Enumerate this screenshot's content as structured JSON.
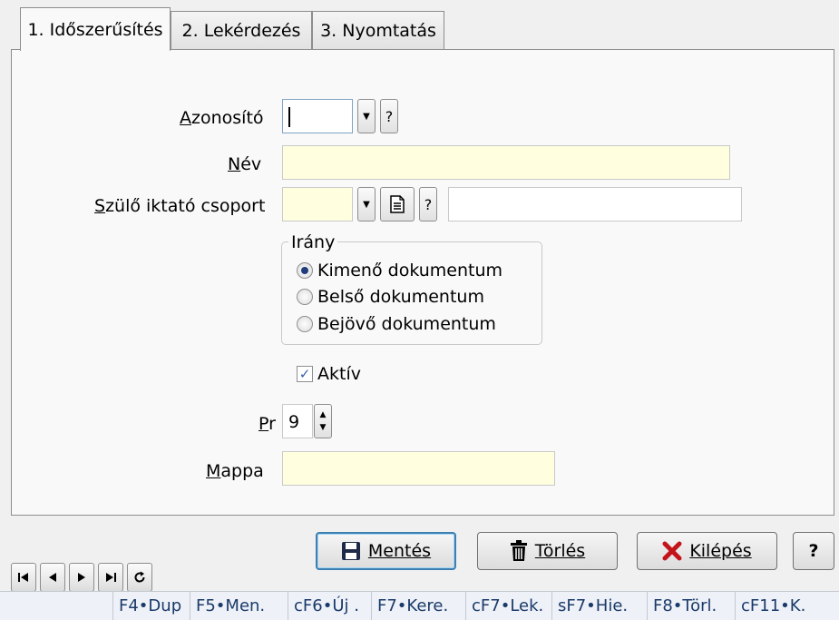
{
  "tabs": [
    {
      "label": "1. Időszerűsítés",
      "active": true
    },
    {
      "label": "2. Lekérdezés",
      "active": false
    },
    {
      "label": "3. Nyomtatás",
      "active": false
    }
  ],
  "form": {
    "azonosito_label": "Azonosító",
    "azonosito_value": "",
    "nev_label": "Név",
    "nev_value": "",
    "szulo_label": "Szülő iktató csoport",
    "szulo_value": "",
    "szulo_desc_value": "",
    "question_mark": "?",
    "irany": {
      "title": "Irány",
      "options": [
        {
          "label": "Kimenő dokumentum",
          "checked": true
        },
        {
          "label": "Belső dokumentum",
          "checked": false
        },
        {
          "label": "Bejövő dokumentum",
          "checked": false
        }
      ]
    },
    "aktiv_label": "Aktív",
    "aktiv_checked": true,
    "pr_label": "Pr",
    "pr_value": "9",
    "mappa_label": "Mappa",
    "mappa_value": ""
  },
  "buttons": {
    "save": "Mentés",
    "delete": "Törlés",
    "exit": "Kilépés",
    "help": "?"
  },
  "statusbar": [
    "F4•Dup",
    "F5•Men.",
    "cF6•Új .",
    "F7•Kere.",
    "cF7•Lek.",
    "sF7•Hie.",
    "F8•Törl.",
    "cF11•K."
  ],
  "icons": {
    "dropdown": "triangle-down",
    "document": "document-icon",
    "nav": [
      "first-record-icon",
      "prev-record-icon",
      "next-record-icon",
      "last-record-icon",
      "refresh-icon"
    ]
  }
}
